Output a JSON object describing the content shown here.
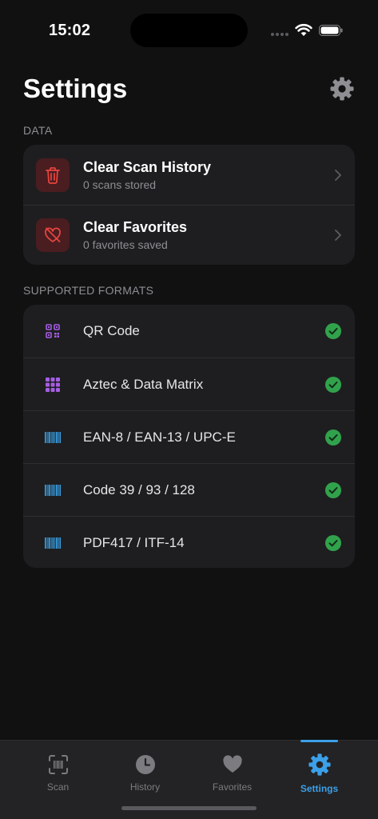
{
  "status": {
    "time": "15:02"
  },
  "header": {
    "title": "Settings",
    "gear_icon": "gear-icon"
  },
  "colors": {
    "accent": "#3ca0e8",
    "destructive": "#e5443f",
    "destructive_tile": "#4a1d20",
    "format_purple": "#a55ee3",
    "format_blue": "#3ba3e8",
    "check_green": "#31a24c"
  },
  "data_section": {
    "label": "DATA",
    "items": [
      {
        "title": "Clear Scan History",
        "subtitle": "0 scans stored",
        "icon": "trash-icon"
      },
      {
        "title": "Clear Favorites",
        "subtitle": "0 favorites saved",
        "icon": "heart-slash-icon"
      }
    ]
  },
  "formats_section": {
    "label": "SUPPORTED FORMATS",
    "items": [
      {
        "label": "QR Code",
        "icon": "qr-code-icon",
        "supported": true
      },
      {
        "label": "Aztec & Data Matrix",
        "icon": "grid-dots-icon",
        "supported": true
      },
      {
        "label": "EAN-8 / EAN-13 / UPC-E",
        "icon": "barcode-icon",
        "supported": true
      },
      {
        "label": "Code 39 / 93 / 128",
        "icon": "barcode-icon",
        "supported": true
      },
      {
        "label": "PDF417 / ITF-14",
        "icon": "barcode-icon",
        "supported": true
      }
    ]
  },
  "tabs": [
    {
      "label": "Scan",
      "icon": "barcode-viewfinder-icon",
      "active": false
    },
    {
      "label": "History",
      "icon": "clock-icon",
      "active": false
    },
    {
      "label": "Favorites",
      "icon": "heart-icon",
      "active": false
    },
    {
      "label": "Settings",
      "icon": "gear-icon",
      "active": true
    }
  ]
}
